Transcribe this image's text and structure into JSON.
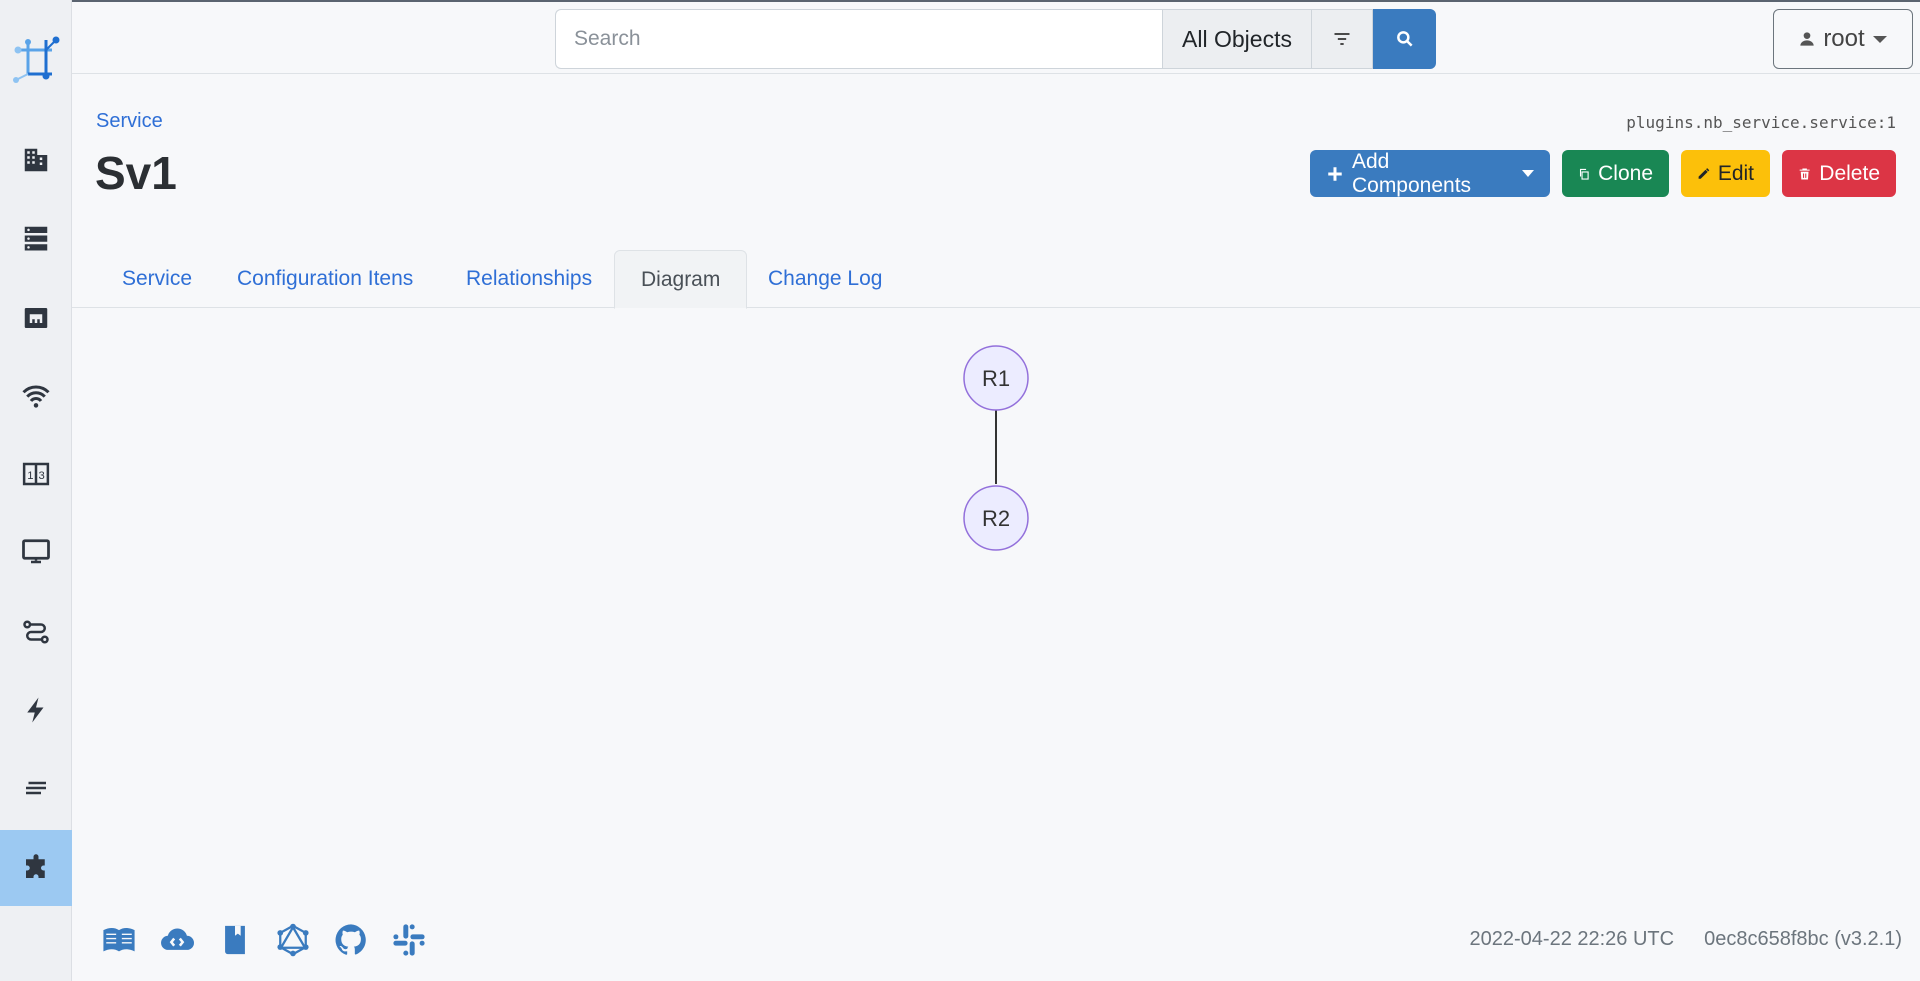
{
  "topbar": {
    "search_placeholder": "Search",
    "object_scope": "All Objects",
    "user": "root"
  },
  "sidebar": {
    "items": [
      {
        "icon": "organization-icon"
      },
      {
        "icon": "devices-icon"
      },
      {
        "icon": "ipam-icon"
      },
      {
        "icon": "wireless-icon"
      },
      {
        "icon": "circuits-icon"
      },
      {
        "icon": "virtualization-icon"
      },
      {
        "icon": "connections-icon"
      },
      {
        "icon": "power-icon"
      },
      {
        "icon": "other-icon"
      },
      {
        "icon": "plugins-icon",
        "active": true
      }
    ]
  },
  "header": {
    "breadcrumb": "Service",
    "title": "Sv1",
    "object_id": "plugins.nb_service.service:1"
  },
  "actions": {
    "add_components": "Add Components",
    "clone": "Clone",
    "edit": "Edit",
    "delete": "Delete"
  },
  "tabs": [
    {
      "label": "Service"
    },
    {
      "label": "Configuration Itens"
    },
    {
      "label": "Relationships"
    },
    {
      "label": "Diagram",
      "active": true
    },
    {
      "label": "Change Log"
    }
  ],
  "diagram": {
    "nodes": [
      "R1",
      "R2"
    ],
    "edges": [
      [
        "R1",
        "R2"
      ]
    ],
    "node_fill": "#ececff",
    "node_stroke": "#9370db"
  },
  "footer": {
    "timestamp": "2022-04-22 22:26 UTC",
    "version": "0ec8c658f8bc (v3.2.1)"
  }
}
